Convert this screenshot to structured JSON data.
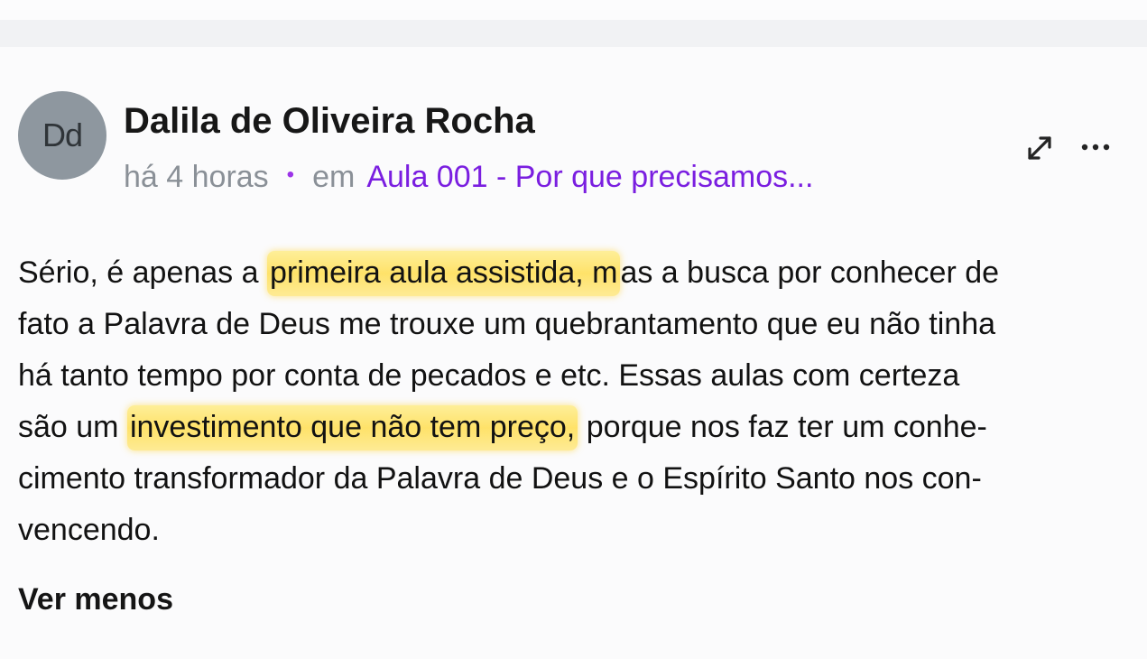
{
  "post": {
    "avatar_initials": "Dd",
    "author": "Dalila de Oliveira Rocha",
    "timestamp": "há 4 horas",
    "separator": "•",
    "context_prefix": "em",
    "lesson_title": "Aula 001 - Por que precisamos..."
  },
  "icons": {
    "expand": "expand-icon",
    "more": "more-options-icon"
  },
  "colors": {
    "avatar_background": "#8e979f",
    "link_purple": "#7a1ee0",
    "dot_purple": "#9c34e8",
    "highlight_yellow": "#ffe066",
    "muted_text": "#8a9097"
  },
  "comment": {
    "line1_before": "Sério, é apenas a ",
    "line1_highlight": "primeira aula assistida, m",
    "line1_after": "as a busca por conhecer de",
    "line2": "fato a Palavra de Deus me trouxe um quebrantamento que eu não tinha",
    "line3": "há tanto tempo por conta de pecados e etc. Essas aulas com certeza",
    "line4_before": "são um ",
    "line4_highlight": "investimento que não tem preço,",
    "line4_after": " porque nos faz ter um conhe-",
    "line5": "cimento transformador da Palavra de Deus e o Espírito Santo nos con-",
    "line6": "vencendo."
  },
  "actions": {
    "see_less": "Ver menos"
  }
}
